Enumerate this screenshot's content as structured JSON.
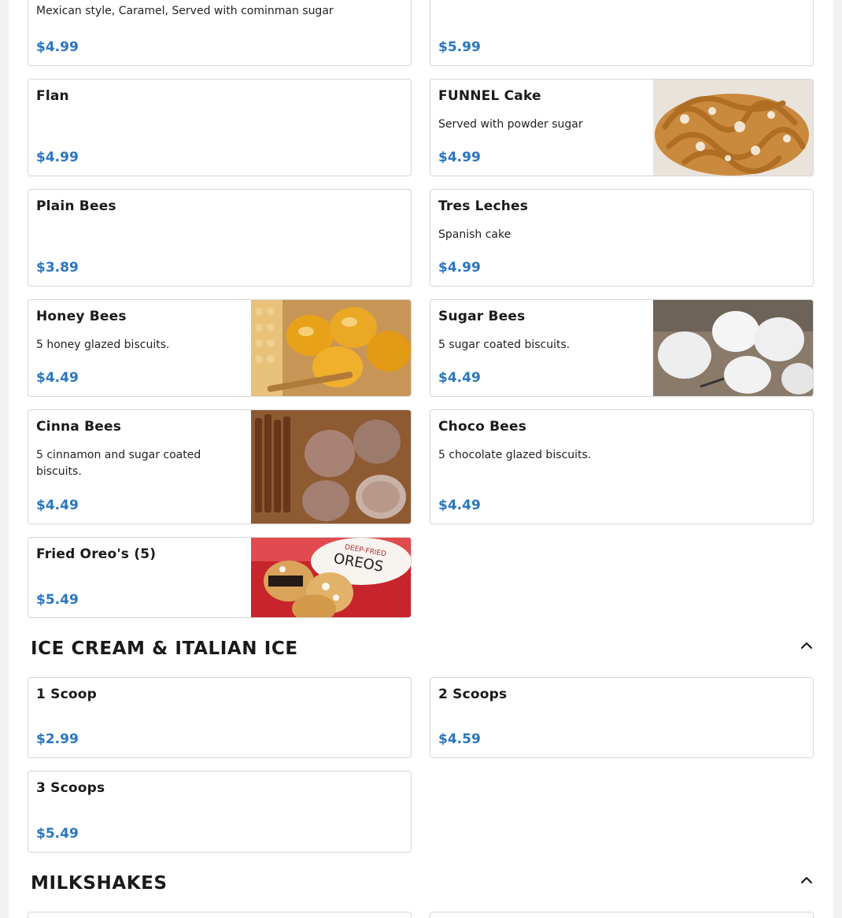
{
  "items": [
    {
      "name": "",
      "desc": "Mexican style, Caramel, Served with cominman sugar",
      "price": "$4.99"
    },
    {
      "name": "",
      "desc": "",
      "price": "$5.99"
    },
    {
      "name": "Flan",
      "desc": "",
      "price": "$4.99"
    },
    {
      "name": "FUNNEL Cake",
      "desc": "Served with powder sugar",
      "price": "$4.99",
      "image": "funnel-cake-photo"
    },
    {
      "name": "Plain Bees",
      "desc": "",
      "price": "$3.89"
    },
    {
      "name": "Tres Leches",
      "desc": "Spanish cake",
      "price": "$4.99"
    },
    {
      "name": "Honey Bees",
      "desc": "5 honey glazed biscuits.",
      "price": "$4.49",
      "image": "honey-bees-photo"
    },
    {
      "name": "Sugar Bees",
      "desc": "5 sugar coated biscuits.",
      "price": "$4.49",
      "image": "sugar-bees-photo"
    },
    {
      "name": "Cinna Bees",
      "desc": "5 cinnamon and sugar coated biscuits.",
      "price": "$4.49",
      "image": "cinna-bees-photo"
    },
    {
      "name": "Choco Bees",
      "desc": "5 chocolate glazed biscuits.",
      "price": "$4.49"
    },
    {
      "name": "Fried Oreo's (5)",
      "desc": "",
      "price": "$5.49",
      "image": "fried-oreos-photo",
      "image_text": [
        "DEEP-FRIED",
        "OREOS"
      ]
    }
  ],
  "sections": [
    {
      "title": "ICE CREAM & ITALIAN ICE",
      "icon": "chevron-up-icon"
    },
    {
      "title": "MILKSHAKES",
      "icon": "chevron-up-icon"
    }
  ],
  "ice_cream": [
    {
      "name": "1 Scoop",
      "price": "$2.99"
    },
    {
      "name": "2 Scoops",
      "price": "$4.59"
    },
    {
      "name": "3 Scoops",
      "price": "$5.49"
    }
  ],
  "colors": {
    "price": "#2a76c0",
    "border": "#d6d6d6",
    "background": "#f2f2f2"
  }
}
